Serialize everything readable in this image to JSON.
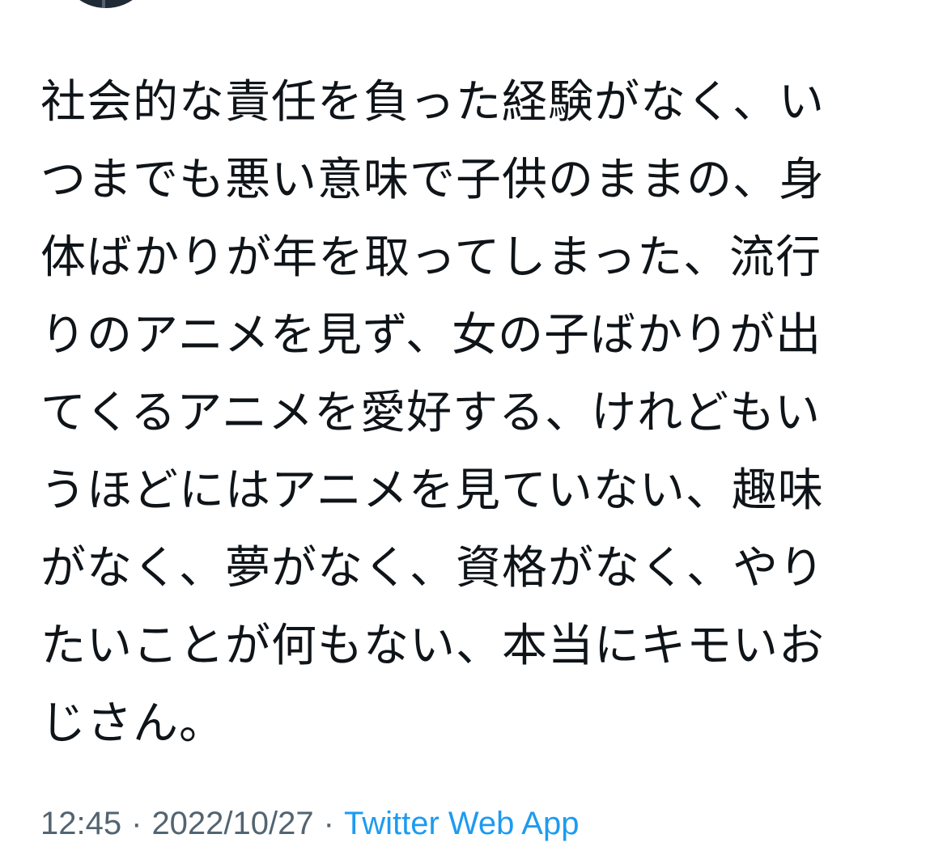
{
  "tweet": {
    "lines": [
      "社会的な責任を負った経験がなく、い",
      "つまでも悪い意味で子供のままの、身",
      "体ばかりが年を取ってしまった、流行",
      "りのアニメを見ず、女の子ばかりが出",
      "てくるアニメを愛好する、けれどもい",
      "うほどにはアニメを見ていない、趣味",
      "がなく、夢がなく、資格がなく、やり",
      "たいことが何もない、本当にキモいお",
      "じさん。"
    ]
  },
  "meta": {
    "time": "12:45",
    "separator": "·",
    "date": "2022/10/27",
    "source": "Twitter Web App"
  },
  "colors": {
    "text": "#0f1419",
    "meta": "#536471",
    "link": "#1d9bf0",
    "background": "#ffffff"
  }
}
